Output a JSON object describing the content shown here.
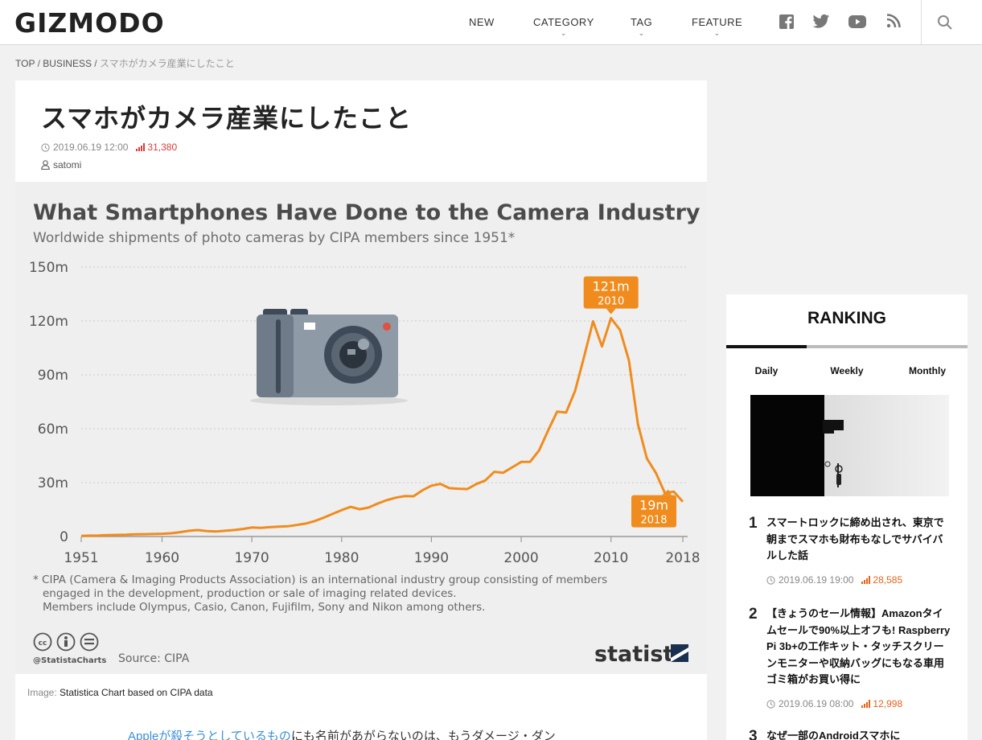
{
  "header": {
    "logo": "GIZMODO",
    "nav": [
      {
        "label": "NEW",
        "has_dropdown": false
      },
      {
        "label": "CATEGORY",
        "has_dropdown": true
      },
      {
        "label": "TAG",
        "has_dropdown": true
      },
      {
        "label": "FEATURE",
        "has_dropdown": true
      }
    ],
    "social_icons": [
      "facebook-icon",
      "twitter-icon",
      "youtube-icon",
      "rss-icon"
    ],
    "search_icon": "search-icon"
  },
  "breadcrumb": {
    "items": [
      "TOP",
      "BUSINESS"
    ],
    "separator": "/",
    "current": "スマホがカメラ産業にしたこと"
  },
  "article": {
    "title": "スマホがカメラ産業にしたこと",
    "date": "2019.06.19 12:00",
    "views": "31,380",
    "author": "satomi",
    "caption_label": "Image:",
    "caption_text": "Statistica Chart based on CIPA data",
    "body_link": "Appleが殺そうとしているもの",
    "body_text": "にも名前があがらないのは、もうダメージ・ダン"
  },
  "chart_data": {
    "type": "line",
    "title": "What Smartphones Have Done to the Camera Industry",
    "subtitle": "Worldwide shipments of photo cameras by CIPA members since 1951*",
    "xlabel": "",
    "ylabel": "",
    "ylim": [
      0,
      150
    ],
    "xlim": [
      1951,
      2018
    ],
    "y_ticks": [
      "0",
      "30m",
      "60m",
      "90m",
      "120m",
      "150m"
    ],
    "x_ticks": [
      "1951",
      "1960",
      "1970",
      "1980",
      "1990",
      "2000",
      "2010",
      "2018"
    ],
    "grid": true,
    "line_color": "#f08c1e",
    "x": [
      1951,
      1952,
      1953,
      1954,
      1955,
      1956,
      1957,
      1958,
      1959,
      1960,
      1961,
      1962,
      1963,
      1964,
      1965,
      1966,
      1967,
      1968,
      1969,
      1970,
      1971,
      1972,
      1973,
      1974,
      1975,
      1976,
      1977,
      1978,
      1979,
      1980,
      1981,
      1982,
      1983,
      1984,
      1985,
      1986,
      1987,
      1988,
      1989,
      1990,
      1991,
      1992,
      1993,
      1994,
      1995,
      1996,
      1997,
      1998,
      1999,
      2000,
      2001,
      2002,
      2003,
      2004,
      2005,
      2006,
      2007,
      2008,
      2009,
      2010,
      2011,
      2012,
      2013,
      2014,
      2015,
      2016,
      2017,
      2018
    ],
    "values": [
      0.3,
      0.5,
      0.6,
      0.8,
      0.9,
      1.0,
      1.2,
      1.3,
      1.4,
      1.5,
      1.8,
      2.4,
      3.2,
      3.6,
      3.0,
      2.8,
      3.2,
      3.6,
      4.2,
      5.0,
      4.8,
      5.2,
      5.5,
      5.7,
      6.4,
      7.2,
      8.6,
      10.5,
      12.6,
      14.7,
      16.5,
      15.2,
      16.1,
      18.3,
      20.2,
      21.6,
      22.5,
      22.4,
      25.7,
      28.3,
      29.3,
      26.9,
      26.6,
      26.4,
      29.2,
      31.2,
      36.0,
      35.5,
      38.5,
      41.5,
      41.6,
      48.0,
      59.0,
      69.5,
      69.0,
      81.0,
      100.0,
      119.8,
      105.8,
      121.5,
      115.0,
      98.0,
      62.5,
      43.5,
      35.4,
      24.2,
      25.0,
      19.4
    ],
    "annotations": [
      {
        "value": "121m",
        "year": "2010",
        "x": 2010,
        "y": 121.5
      },
      {
        "value": "19m",
        "year": "2018",
        "x": 2018,
        "y": 19.4
      }
    ],
    "footnote": [
      "* CIPA (Camera & Imaging Products Association) is an international industry group consisting of members",
      "engaged in the development, production or sale of imaging related devices.",
      "Members include Olympus, Casio, Canon, Fujifilm, Sony and Nikon among others."
    ],
    "credit": "@StatistaCharts",
    "source": "Source: CIPA",
    "brand": "statista"
  },
  "ranking": {
    "heading": "RANKING",
    "tabs": [
      "Daily",
      "Weekly",
      "Monthly"
    ],
    "active_tab": "Daily",
    "items": [
      {
        "rank": "1",
        "title": "スマートロックに締め出され、東京で朝までスマホも財布もなしでサバイバルした話",
        "date": "2019.06.19 19:00",
        "views": "28,585"
      },
      {
        "rank": "2",
        "title": "【きょうのセール情報】Amazonタイムセールで90%以上オフも! Raspberry Pi 3b+の工作キット・タッチスクリーンモニターや収納バッグにもなる車用ゴミ箱がお買い得に",
        "date": "2019.06.19 08:00",
        "views": "12,998"
      },
      {
        "rank": "3",
        "title": "なぜ一部のAndroidスマホに"
      }
    ]
  }
}
